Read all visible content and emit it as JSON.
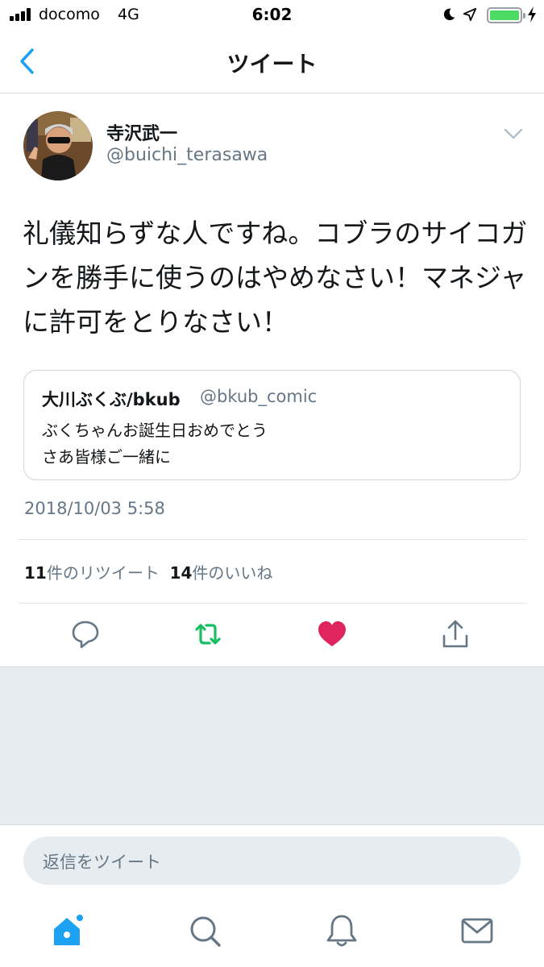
{
  "status_bar": {
    "carrier": "docomo",
    "network": "4G",
    "time": "6:02"
  },
  "nav": {
    "title": "ツイート"
  },
  "tweet": {
    "display_name": "寺沢武一",
    "handle": "@buichi_terasawa",
    "text": "礼儀知らずな人ですね。コブラのサイコガンを勝手に使うのはやめなさい！マネジャに許可をとりなさい！",
    "timestamp": "2018/10/03 5:58"
  },
  "quoted_tweet": {
    "display_name": "大川ぶくぶ/bkub",
    "handle": "@bkub_comic",
    "line1": "ぶくちゃんお誕生日おめでとう",
    "line2": "さあ皆様ご一緒に"
  },
  "stats": {
    "retweet_count": "11",
    "retweet_label": "件のリツイート",
    "like_count": "14",
    "like_label": "件のいいね"
  },
  "actions": {
    "retweet_color": "#17bf63",
    "like_color": "#e0245e",
    "icon_color": "#657786"
  },
  "reply": {
    "placeholder": "返信をツイート"
  },
  "accent_color": "#1da1f2"
}
